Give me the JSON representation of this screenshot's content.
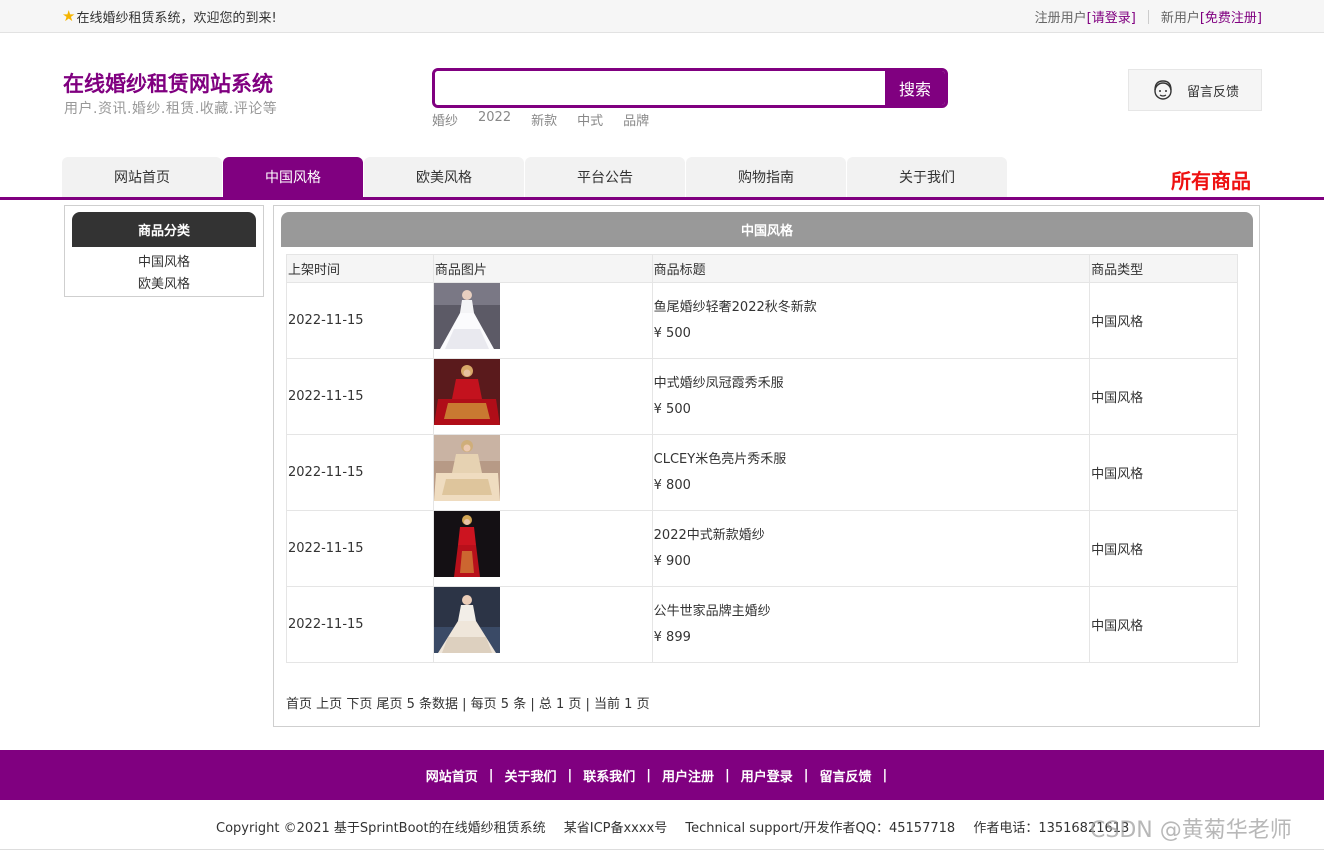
{
  "topbar": {
    "welcome": "在线婚纱租赁系统，欢迎您的到来!",
    "registered_label": "注册用户",
    "login_link": "[请登录]",
    "new_user_label": "新用户",
    "register_link": "[免费注册]"
  },
  "header": {
    "title": "在线婚纱租赁网站系统",
    "subtitle": "用户.资讯.婚纱.租赁.收藏.评论等",
    "search_placeholder": "",
    "search_button": "搜索",
    "hotwords": [
      "婚纱",
      "2022",
      "新款",
      "中式",
      "品牌"
    ],
    "feedback": "留言反馈"
  },
  "nav": {
    "tabs": [
      {
        "label": "网站首页",
        "active": false
      },
      {
        "label": "中国风格",
        "active": true
      },
      {
        "label": "欧美风格",
        "active": false
      },
      {
        "label": "平台公告",
        "active": false
      },
      {
        "label": "购物指南",
        "active": false
      },
      {
        "label": "关于我们",
        "active": false
      }
    ],
    "all_goods": "所有商品"
  },
  "sidebar": {
    "title": "商品分类",
    "items": [
      "中国风格",
      "欧美风格"
    ]
  },
  "main": {
    "title": "中国风格",
    "columns": [
      "上架时间",
      "商品图片",
      "商品标题",
      "商品类型"
    ],
    "rows": [
      {
        "date": "2022-11-15",
        "title": "鱼尾婚纱轻奢2022秋冬新款",
        "price": "¥ 500",
        "type": "中国风格",
        "image": "white-gown"
      },
      {
        "date": "2022-11-15",
        "title": "中式婚纱凤冠霞秀禾服",
        "price": "¥ 500",
        "type": "中国风格",
        "image": "red-xiuhe"
      },
      {
        "date": "2022-11-15",
        "title": "CLCEY米色亮片秀禾服",
        "price": "¥ 800",
        "type": "中国风格",
        "image": "beige-xiuhe"
      },
      {
        "date": "2022-11-15",
        "title": "2022中式新款婚纱",
        "price": "¥ 900",
        "type": "中国风格",
        "image": "red-dress-dark"
      },
      {
        "date": "2022-11-15",
        "title": "公牛世家品牌主婚纱",
        "price": "¥ 899",
        "type": "中国风格",
        "image": "white-gown-blue"
      }
    ],
    "pager": {
      "first": "首页",
      "prev": "上页",
      "next": "下页",
      "last": "尾页",
      "summary": "5 条数据 | 每页 5 条 | 总 1 页 | 当前 1 页"
    }
  },
  "footer": {
    "links": [
      "网站首页",
      "关于我们",
      "联系我们",
      "用户注册",
      "用户登录",
      "留言反馈"
    ],
    "divider": "|",
    "copyright": "Copyright ©2021 基于SprintBoot的在线婚纱租赁系统",
    "icp": "某省ICP备xxxx号",
    "support": "Technical support/开发作者QQ：45157718",
    "phone": "作者电话：13516821613",
    "watermark": "CSDN @黄菊华老师"
  },
  "colors": {
    "brand": "#800080",
    "accent_red": "#ee1111",
    "sidebar_head": "#333333",
    "panel_head": "#999999"
  }
}
